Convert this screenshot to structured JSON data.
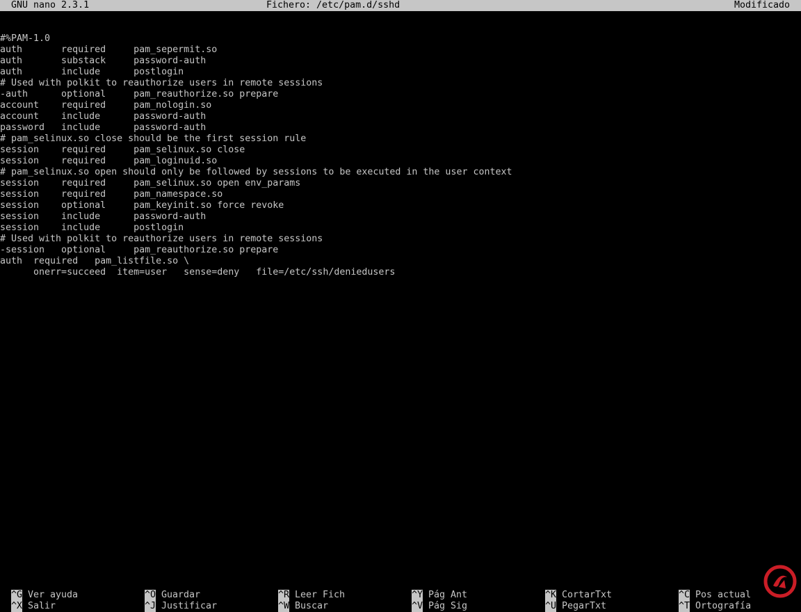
{
  "colors": {
    "background": "#000000",
    "foreground": "#c6c6c6",
    "bar": "#c6c6c6",
    "bar_text": "#000000",
    "watermark": "#e0202a"
  },
  "titlebar": {
    "app": "GNU nano 2.3.1",
    "file": "Fichero: /etc/pam.d/sshd",
    "status": "Modificado"
  },
  "editor": {
    "lines": [
      "",
      "#%PAM-1.0",
      "auth       required     pam_sepermit.so",
      "auth       substack     password-auth",
      "auth       include      postlogin",
      "# Used with polkit to reauthorize users in remote sessions",
      "-auth      optional     pam_reauthorize.so prepare",
      "account    required     pam_nologin.so",
      "account    include      password-auth",
      "password   include      password-auth",
      "# pam_selinux.so close should be the first session rule",
      "session    required     pam_selinux.so close",
      "session    required     pam_loginuid.so",
      "# pam_selinux.so open should only be followed by sessions to be executed in the user context",
      "session    required     pam_selinux.so open env_params",
      "session    required     pam_namespace.so",
      "session    optional     pam_keyinit.so force revoke",
      "session    include      password-auth",
      "session    include      postlogin",
      "# Used with polkit to reauthorize users in remote sessions",
      "-session   optional     pam_reauthorize.so prepare",
      "auth  required   pam_listfile.so \\",
      "      onerr=succeed  item=user   sense=deny   file=/etc/ssh/deniedusers"
    ]
  },
  "shortcuts": {
    "row1": [
      {
        "key": "^G",
        "label": "Ver ayuda"
      },
      {
        "key": "^O",
        "label": "Guardar"
      },
      {
        "key": "^R",
        "label": "Leer Fich"
      },
      {
        "key": "^Y",
        "label": "Pág Ant"
      },
      {
        "key": "^K",
        "label": "CortarTxt"
      },
      {
        "key": "^C",
        "label": "Pos actual"
      }
    ],
    "row2": [
      {
        "key": "^X",
        "label": "Salir"
      },
      {
        "key": "^J",
        "label": "Justificar"
      },
      {
        "key": "^W",
        "label": "Buscar"
      },
      {
        "key": "^V",
        "label": "Pág Sig"
      },
      {
        "key": "^U",
        "label": "PegarTxt"
      },
      {
        "key": "^T",
        "label": "Ortografía"
      }
    ]
  },
  "watermark": {
    "icon": "brand-logo-icon"
  }
}
